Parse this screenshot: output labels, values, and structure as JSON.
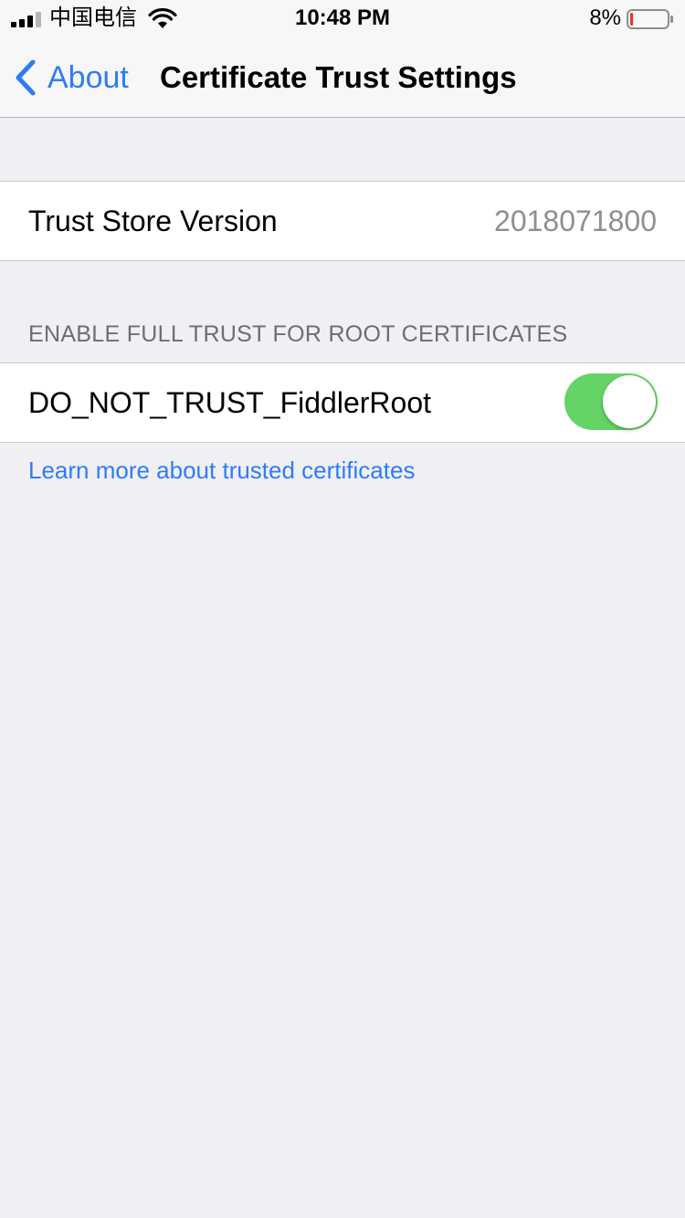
{
  "status_bar": {
    "carrier": "中国电信",
    "time": "10:48 PM",
    "battery_percent": "8%",
    "battery_level": 0.08,
    "battery_color": "#e5372b"
  },
  "nav": {
    "back_label": "About",
    "title": "Certificate Trust Settings"
  },
  "trust_store": {
    "label": "Trust Store Version",
    "value": "2018071800"
  },
  "full_trust_section": {
    "header": "ENABLE FULL TRUST FOR ROOT CERTIFICATES",
    "certificates": [
      {
        "name": "DO_NOT_TRUST_FiddlerRoot",
        "enabled": true
      }
    ]
  },
  "learn_more_link": "Learn more about trusted certificates",
  "colors": {
    "accent": "#2f7cf6",
    "toggle_on": "#65d366",
    "background": "#efeff4"
  }
}
